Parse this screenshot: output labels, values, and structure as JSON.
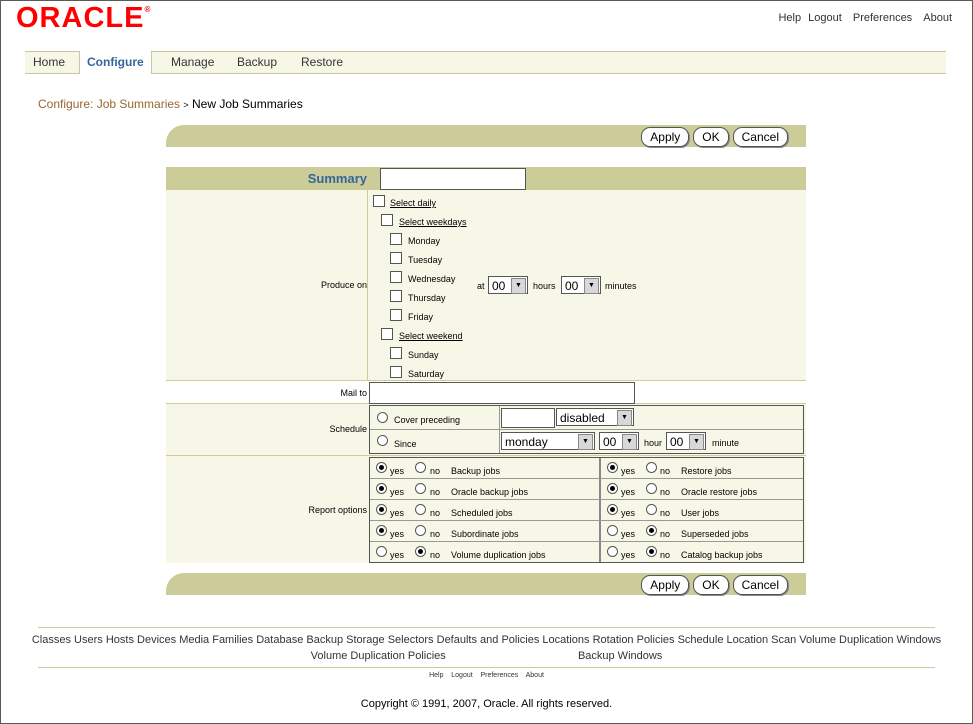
{
  "brand": {
    "logo": "ORACLE",
    "mark": "®"
  },
  "top_links": [
    "Help",
    "Logout",
    "Preferences",
    "About"
  ],
  "tabs": [
    "Home",
    "Configure",
    "Manage",
    "Backup",
    "Restore"
  ],
  "active_tab": "Configure",
  "breadcrumb": {
    "parent": "Configure: Job Summaries",
    "sep": ">",
    "current": "New Job Summaries"
  },
  "buttons": {
    "apply": "Apply",
    "ok": "OK",
    "cancel": "Cancel"
  },
  "form": {
    "summary_label": "Summary",
    "summary_value": "",
    "produce_label": "Produce on",
    "select_daily": "Select daily",
    "select_weekdays": "Select weekdays",
    "weekdays": [
      "Monday",
      "Tuesday",
      "Wednesday",
      "Thursday",
      "Friday"
    ],
    "select_weekend": "Select weekend",
    "weekend": [
      "Sunday",
      "Saturday"
    ],
    "at_label": "at",
    "hours_value": "00",
    "hours_label": "hours",
    "minutes_value": "00",
    "minutes_label": "minutes",
    "mail_label": "Mail to",
    "mail_value": "",
    "schedule_label": "Schedule",
    "cover_label": "Cover preceding",
    "cover_value": "",
    "cover_select": "disabled",
    "since_label": "Since",
    "since_day": "monday",
    "since_hour": "00",
    "hour_label": "hour",
    "since_minute": "00",
    "minute_label": "minute",
    "report_label": "Report options",
    "yes": "yes",
    "no": "no",
    "report_left": [
      {
        "label": "Backup jobs",
        "value": "yes"
      },
      {
        "label": "Oracle backup jobs",
        "value": "yes"
      },
      {
        "label": "Scheduled jobs",
        "value": "yes"
      },
      {
        "label": "Subordinate jobs",
        "value": "yes"
      },
      {
        "label": "Volume duplication jobs",
        "value": "no"
      }
    ],
    "report_right": [
      {
        "label": "Restore jobs",
        "value": "yes"
      },
      {
        "label": "Oracle restore jobs",
        "value": "yes"
      },
      {
        "label": "User jobs",
        "value": "yes"
      },
      {
        "label": "Superseded jobs",
        "value": "no"
      },
      {
        "label": "Catalog backup jobs",
        "value": "no"
      }
    ]
  },
  "footer_links_line1": [
    "Classes",
    "Users",
    "Hosts",
    "Devices",
    "Media Families",
    "Database Backup Storage Selectors",
    "Defaults and Policies",
    "Locations",
    "Rotation Policies",
    "Schedule Location Scan",
    "Volume Duplication Windows"
  ],
  "footer_links_line2": [
    "Volume Duplication Policies",
    "Backup Windows"
  ],
  "footer_small_links": [
    "Help",
    "Logout",
    "Preferences",
    "About"
  ],
  "copyright": "Copyright © 1991, 2007, Oracle. All rights reserved."
}
